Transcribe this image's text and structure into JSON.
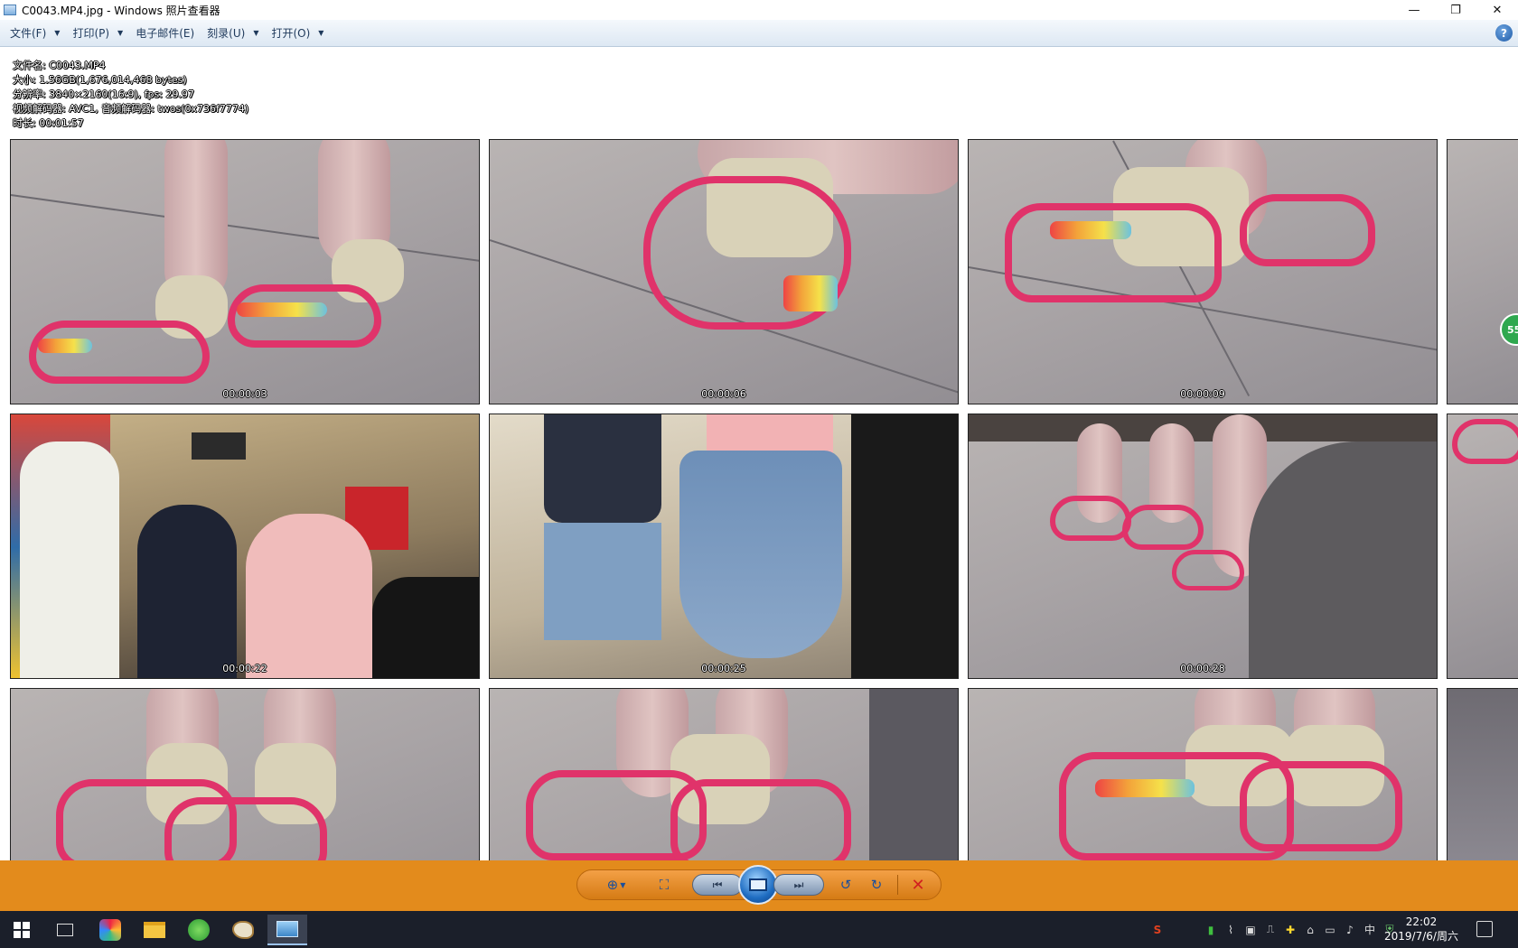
{
  "window": {
    "title": "C0043.MP4.jpg - Windows 照片查看器",
    "controls": {
      "minimize": "—",
      "restore": "❐",
      "close": "✕"
    }
  },
  "menubar": {
    "items": [
      {
        "label": "文件(F)",
        "has_dropdown": true
      },
      {
        "label": "打印(P)",
        "has_dropdown": true
      },
      {
        "label": "电子邮件(E)",
        "has_dropdown": false
      },
      {
        "label": "刻录(U)",
        "has_dropdown": true
      },
      {
        "label": "打开(O)",
        "has_dropdown": true
      }
    ],
    "help": "?"
  },
  "info": {
    "filename": "文件名: C0043.MP4",
    "size": "大小: 1.56GB(1,676,014,468 bytes)",
    "resolution": "分辨率: 3840×2160(16:9), fps: 29.97",
    "codec": "视频解码器: AVC1, 音频解码器: twos(0x736f7774)",
    "duration": "时长: 00:01:57"
  },
  "thumbnails": [
    {
      "timestamp": "00:00:03",
      "scene": "floor"
    },
    {
      "timestamp": "00:00:06",
      "scene": "floor"
    },
    {
      "timestamp": "00:00:09",
      "scene": "floor"
    },
    {
      "timestamp": "00:00:22",
      "scene": "mall"
    },
    {
      "timestamp": "00:00:25",
      "scene": "mall"
    },
    {
      "timestamp": "00:00:28",
      "scene": "floor"
    },
    {
      "timestamp": "",
      "scene": "floor"
    },
    {
      "timestamp": "",
      "scene": "floor"
    },
    {
      "timestamp": "",
      "scene": "floor"
    }
  ],
  "badge": "55",
  "toolbar": {
    "zoom": "⊕",
    "fit": "⛶",
    "prev": "⏮",
    "next": "⏭",
    "rotate_ccw": "↺",
    "rotate_cw": "↻",
    "delete": "✕"
  },
  "taskbar": {
    "clock_time": "22:02",
    "clock_date": "2019/7/6/周六",
    "app_icons": [
      "start-icon",
      "task-view-icon",
      "picture-app-icon",
      "file-explorer-icon",
      "browser-icon",
      "paint-icon",
      "photo-viewer-icon"
    ]
  },
  "colors": {
    "toolbar_bg": "#e38b1c",
    "taskbar_bg": "#1b1f2a",
    "menubar_bg": "#dde8f3"
  }
}
